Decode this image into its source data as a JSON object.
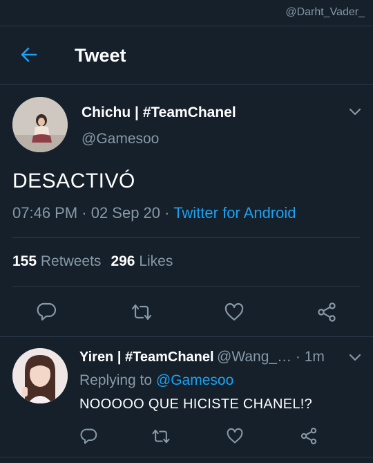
{
  "watermark": "@Darht_Vader_",
  "header": {
    "title": "Tweet"
  },
  "tweet": {
    "author_name": "Chichu | #TeamChanel",
    "author_handle": "@Gamesoo",
    "text": "DESACTIVÓ",
    "time": "07:46 PM · 02 Sep 20 · ",
    "source": "Twitter for Android",
    "retweets_count": "155",
    "retweets_label": "Retweets",
    "likes_count": "296",
    "likes_label": "Likes"
  },
  "reply": {
    "author_name": "Yiren | #TeamChanel",
    "author_handle": "@Wang_…",
    "time": " · 1m",
    "replying_prefix": "Replying to ",
    "replying_handle": "@Gamesoo",
    "text": "NOOOOO QUE HICISTE CHANEL!?"
  },
  "colors": {
    "background": "#15202b",
    "accent": "#1da1f2",
    "secondary_text": "#8899a6",
    "divider": "#2c3a48"
  },
  "icons": [
    "back-arrow-icon",
    "chevron-down-icon",
    "reply-icon",
    "retweet-icon",
    "like-icon",
    "share-icon"
  ]
}
